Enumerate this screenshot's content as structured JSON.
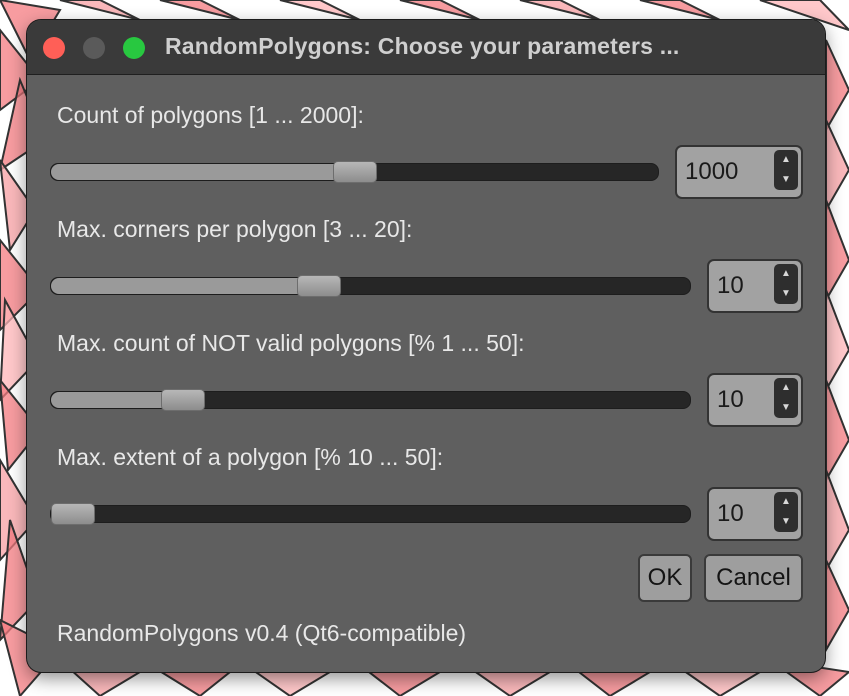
{
  "window": {
    "title": "RandomPolygons: Choose your parameters ...",
    "traffic_lights": [
      "close-button",
      "minimize-button",
      "zoom-button"
    ],
    "colors": {
      "close": "#ff5f57",
      "minimize": "#5a5a5a",
      "zoom": "#28c840"
    }
  },
  "params": [
    {
      "label": "Count of polygons [1 ... 2000]:",
      "value": "1000",
      "min": 1,
      "max": 2000
    },
    {
      "label": "Max. corners per polygon [3 ... 20]:",
      "value": "10",
      "min": 3,
      "max": 20
    },
    {
      "label": "Max. count of NOT valid polygons [% 1 ... 50]:",
      "value": "10",
      "min": 1,
      "max": 50
    },
    {
      "label": "Max. extent of a polygon [% 10 ... 50]:",
      "value": "10",
      "min": 10,
      "max": 50
    }
  ],
  "buttons": {
    "ok": "OK",
    "cancel": "Cancel"
  },
  "footer": "RandomPolygons v0.4 (Qt6-compatible)",
  "spin_arrows": {
    "up": "▲",
    "down": "▼"
  }
}
